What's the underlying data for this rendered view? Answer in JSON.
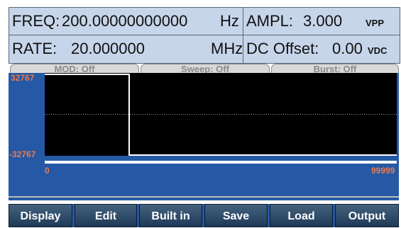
{
  "readout": {
    "freq_label": "FREQ:",
    "freq_value": "200.00000000000",
    "freq_unit": "Hz",
    "ampl_label": "AMPL:",
    "ampl_value": "3.000",
    "ampl_unit": "VPP",
    "rate_label": "RATE:",
    "rate_value": "20.000000",
    "rate_unit": "MHz",
    "dc_label": "DC Offset:",
    "dc_value": "0.00",
    "dc_unit": "VDC"
  },
  "tabs": [
    {
      "label": "MOD: Off"
    },
    {
      "label": "Sweep: Off"
    },
    {
      "label": "Burst: Off"
    }
  ],
  "waveform": {
    "y_max_label": "32767",
    "y_min_label": "-32767",
    "x_min_label": "0",
    "x_max_label": "99999"
  },
  "softkeys": [
    {
      "label": "Display"
    },
    {
      "label": "Edit"
    },
    {
      "label": "Built in"
    },
    {
      "label": "Save"
    },
    {
      "label": "Load"
    },
    {
      "label": "Output"
    }
  ],
  "colors": {
    "readout_bg": "#c7d5ea",
    "waveform_bg": "#2559a6",
    "plot_bg": "#000000",
    "trace": "#ffffff",
    "axis_label": "#ea7a4e"
  }
}
